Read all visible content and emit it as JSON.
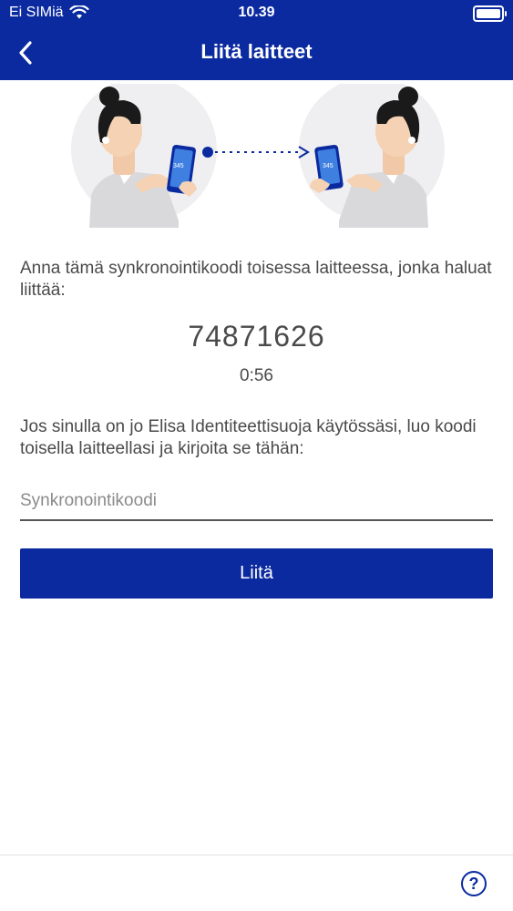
{
  "status_bar": {
    "carrier": "Ei SIMiä",
    "time": "10.39",
    "icons": [
      "wifi-icon",
      "battery-icon"
    ]
  },
  "nav": {
    "title": "Liitä laitteet",
    "back_icon": "chevron-left-icon"
  },
  "illustration": {
    "phone_screen_text_left": "345",
    "phone_screen_text_right": "345"
  },
  "main": {
    "instruction_1": "Anna tämä synkronointikoodi toisessa laitteessa, jonka haluat liittää:",
    "sync_code": "74871626",
    "countdown": "0:56",
    "instruction_2": "Jos sinulla on jo Elisa Identiteettisuoja käytössäsi, luo koodi toisella laitteellasi ja kirjoita se tähän:",
    "code_input": {
      "value": "",
      "placeholder": "Synkronointikoodi"
    },
    "connect_button": "Liitä"
  },
  "footer": {
    "help_icon": "help-circle-icon"
  },
  "colors": {
    "brand_blue": "#0b2aa0",
    "text": "#4a4a4a"
  }
}
